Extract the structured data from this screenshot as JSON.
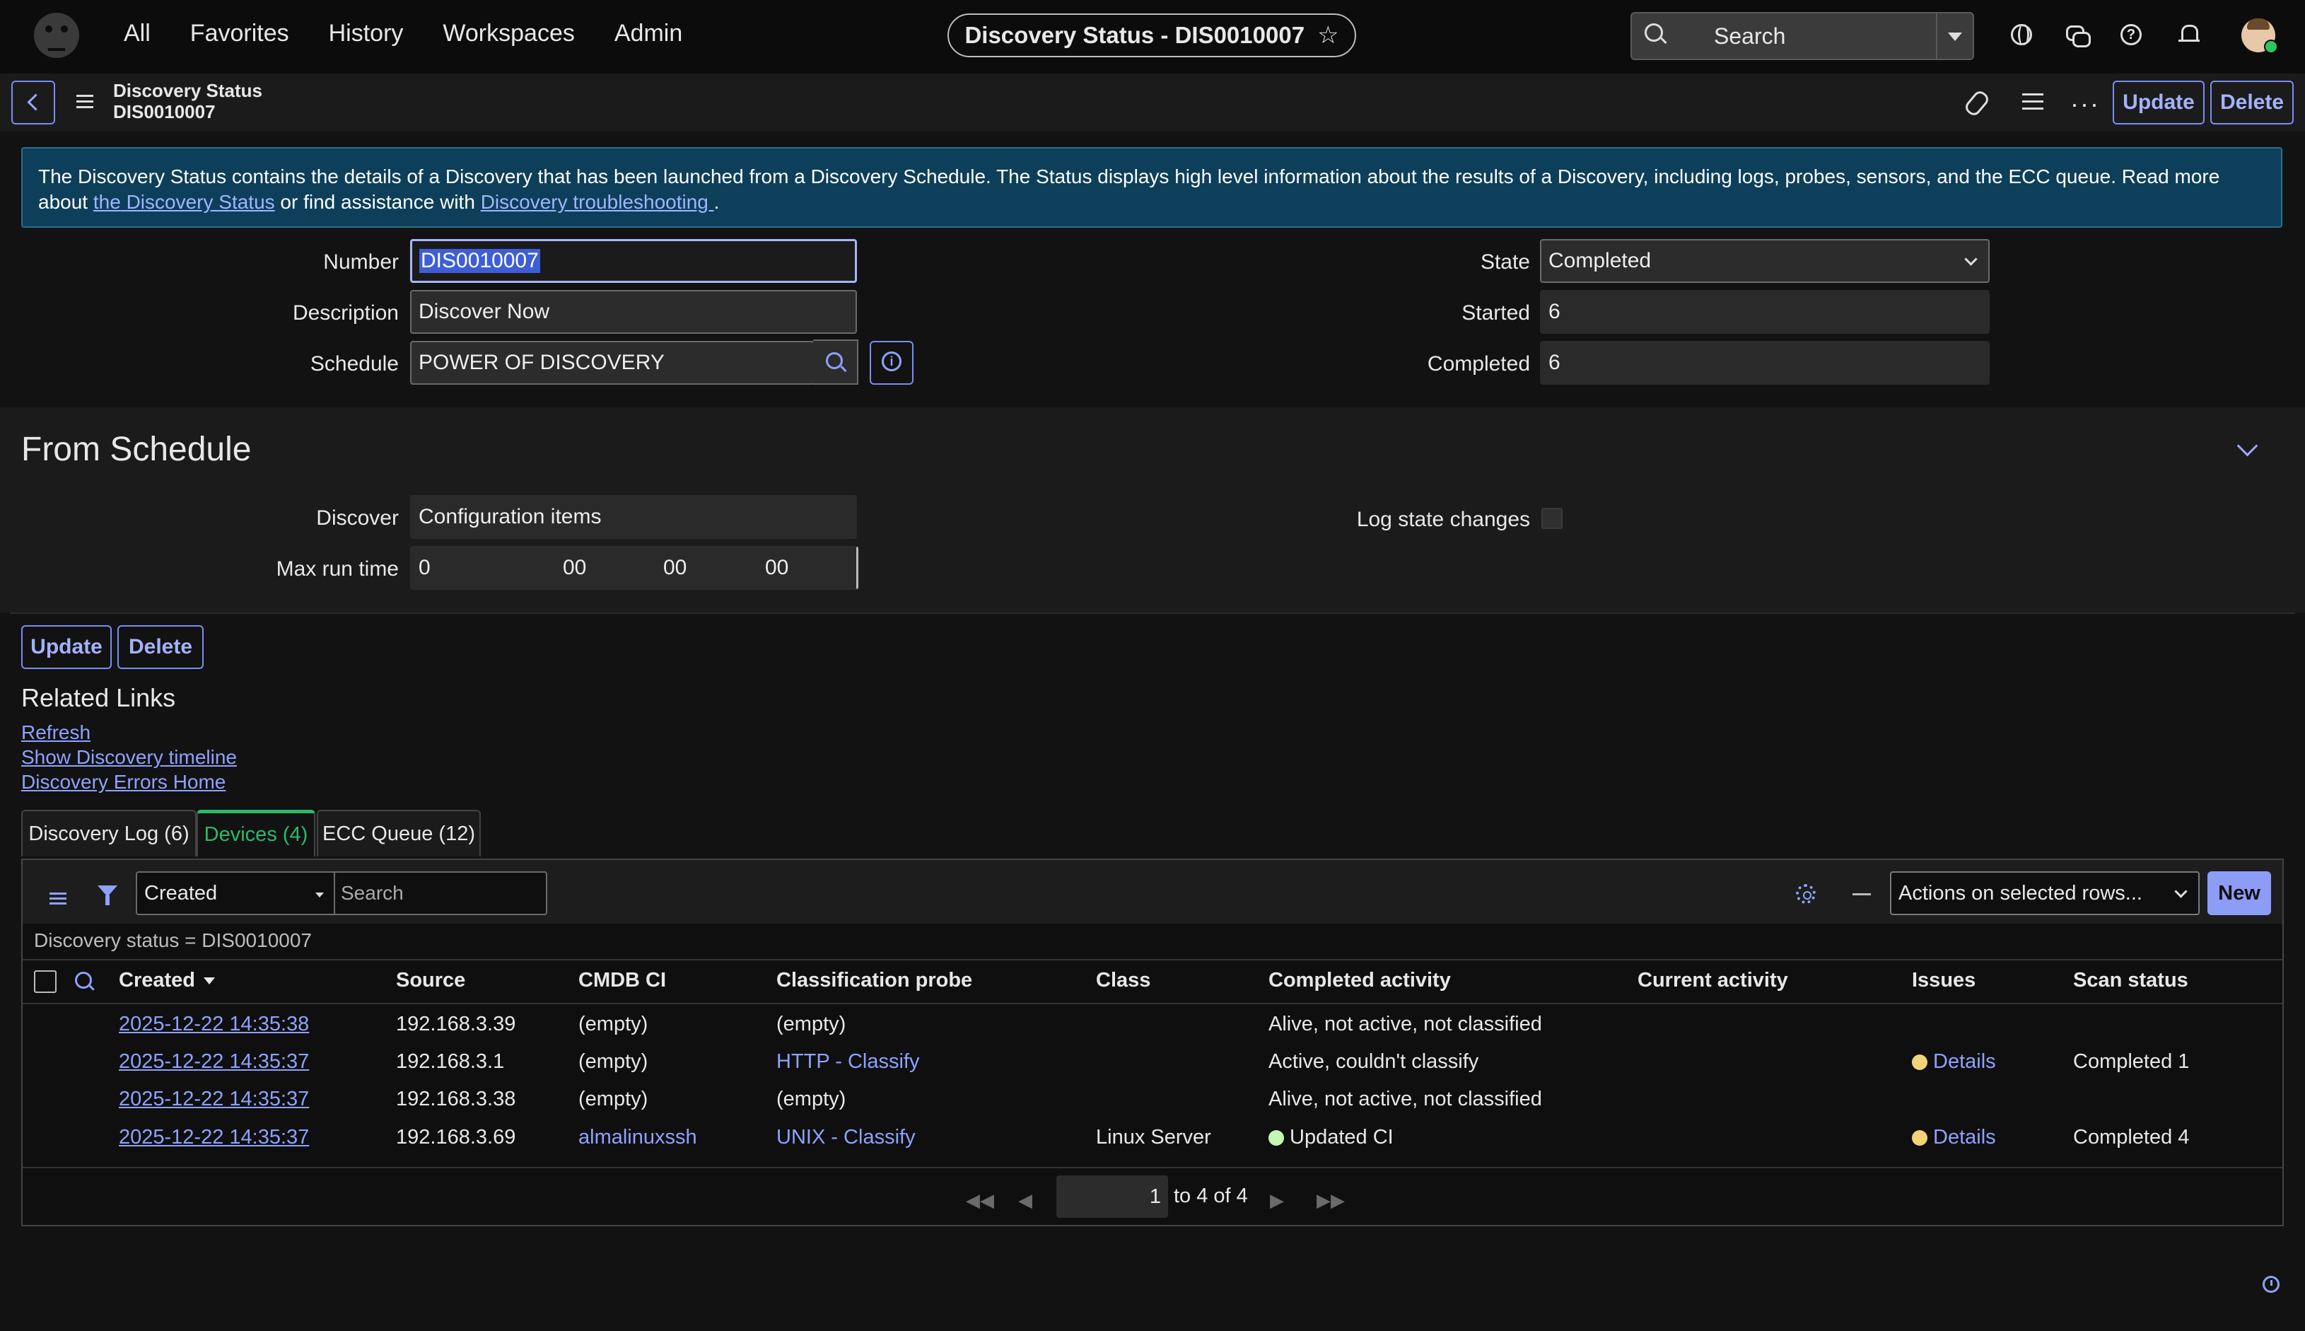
{
  "nav": {
    "menu": [
      "All",
      "Favorites",
      "History",
      "Workspaces",
      "Admin"
    ],
    "record_pill": "Discovery Status - DIS0010007",
    "search_label": "Search"
  },
  "header": {
    "title_line1": "Discovery Status",
    "title_line2": "DIS0010007",
    "update_label": "Update",
    "delete_label": "Delete"
  },
  "banner": {
    "text_before": "The Discovery Status contains the details of a Discovery that has been launched from a Discovery Schedule. The Status displays high level information about the results of a Discovery, including logs, probes, sensors, and the ECC queue. Read more about ",
    "link1_line1": "the",
    "link1_line2": "Discovery Status",
    "text_mid": " or find assistance with ",
    "link2": "Discovery troubleshooting ",
    "text_after": "."
  },
  "form": {
    "number_label": "Number",
    "number_value": "DIS0010007",
    "description_label": "Description",
    "description_value": "Discover Now",
    "schedule_label": "Schedule",
    "schedule_value": "POWER OF DISCOVERY",
    "state_label": "State",
    "state_value": "Completed",
    "started_label": "Started",
    "started_value": "6",
    "completed_label": "Completed",
    "completed_value": "6"
  },
  "schedule_section": {
    "title": "From Schedule",
    "discover_label": "Discover",
    "discover_value": "Configuration items",
    "max_run_label": "Max run time",
    "max_run_days": "0",
    "max_run_hours": "00",
    "max_run_minutes": "00",
    "max_run_seconds": "00",
    "log_state_label": "Log state changes"
  },
  "bottom_buttons": {
    "update": "Update",
    "delete": "Delete"
  },
  "related_links": {
    "title": "Related Links",
    "links": [
      "Refresh",
      "Show Discovery timeline",
      "Discovery Errors Home"
    ]
  },
  "tabs": [
    "Discovery Log (6)",
    "Devices (4)",
    "ECC Queue (12)"
  ],
  "list": {
    "filter_field": "Created",
    "search_placeholder": "Search",
    "actions_label": "Actions on selected rows...",
    "new_label": "New",
    "breadcrumb": "Discovery status = DIS0010007",
    "columns": [
      "Created",
      "Source",
      "CMDB CI",
      "Classification probe",
      "Class",
      "Completed activity",
      "Current activity",
      "Issues",
      "Scan status"
    ],
    "rows": [
      {
        "created": "2025-12-22 14:35:38",
        "source": "192.168.3.39",
        "cmdb_ci": "(empty)",
        "probe": "(empty)",
        "class": "",
        "completed": "Alive, not active, not classified",
        "current": "",
        "issues": "",
        "scan": ""
      },
      {
        "created": "2025-12-22 14:35:37",
        "source": "192.168.3.1",
        "cmdb_ci": "(empty)",
        "probe": "HTTP - Classify",
        "class": "",
        "completed": "Active, couldn't classify",
        "current": "",
        "issues": "Details",
        "scan": "Completed 1"
      },
      {
        "created": "2025-12-22 14:35:37",
        "source": "192.168.3.38",
        "cmdb_ci": "(empty)",
        "probe": "(empty)",
        "class": "",
        "completed": "Alive, not active, not classified",
        "current": "",
        "issues": "",
        "scan": ""
      },
      {
        "created": "2025-12-22 14:35:37",
        "source": "192.168.3.69",
        "cmdb_ci": "almalinuxssh",
        "probe": "UNIX - Classify",
        "class": "Linux Server",
        "completed": "Updated CI",
        "current": "",
        "issues": "Details",
        "scan": "Completed 4"
      }
    ],
    "page_value": "1",
    "page_text": "to 4 of 4"
  },
  "colors": {
    "accent": "#8ea2ff",
    "tab_active": "#2cb86a",
    "issue_dot": "#f2d37a",
    "updated_dot": "#c6f5b4",
    "banner_bg": "#0d3f5a"
  }
}
